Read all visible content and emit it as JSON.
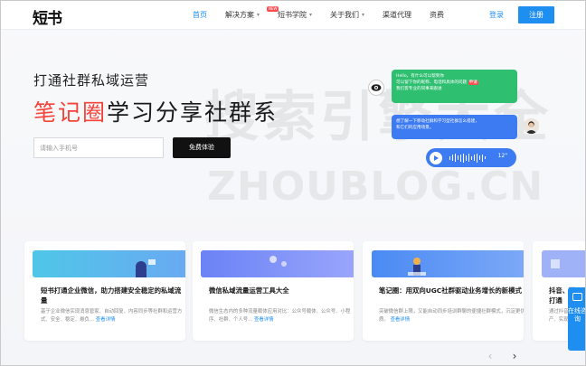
{
  "header": {
    "logo": "短书",
    "nav": [
      {
        "label": "首页",
        "active": true
      },
      {
        "label": "解决方案",
        "badge": "NEW",
        "dropdown": true
      },
      {
        "label": "短书学院",
        "dropdown": true
      },
      {
        "label": "关于我们",
        "dropdown": true
      },
      {
        "label": "渠道代理"
      },
      {
        "label": "资费"
      }
    ],
    "login": "登录",
    "register": "注册"
  },
  "hero": {
    "subtitle": "打通社群私域运营",
    "title_accent": "笔记圈",
    "title_rest": "学习分享社群系",
    "phone_placeholder": "请输入手机号",
    "cta": "免费体验"
  },
  "watermark": {
    "cn": "搜索引擎大全",
    "en": "ZHOUBLOG.CN"
  },
  "chat": {
    "bot_message_1": "Hello，有什么可以帮到你",
    "bot_message_2": "可以留下你的昵称、电话和具体的问题",
    "bot_message_tag": "申请",
    "bot_message_3": "我们客专业的同事来跟进",
    "user_message_1": "想了解一下移动社群和学习型社群怎么搭建，",
    "user_message_2": "和它们的应用场景。",
    "voice_duration": "12\""
  },
  "cards": [
    {
      "title": "短书打通企业微信，助力搭建安全稳定的私域流量",
      "desc": "基于企业微信实现消息管家、自动回复、内容同步等社群和运营方式、安全、稳定、悬负...",
      "more": "查看详情",
      "color_a": "#4fc6e8",
      "color_b": "#6aa9f2"
    },
    {
      "title": "微信私域流量运营工具大全",
      "desc": "微信生态内的多种流量载体应用对比：公众号载体、公众号、小程序、社群、个人号...",
      "more": "查看详情",
      "color_a": "#6a82f6",
      "color_b": "#9aa6fb"
    },
    {
      "title": "笔记圈：用双向UGC社群驱动业务增长的新模式",
      "desc": "突破微信群上限，又能自动同步培训群聊的便捷社群模式，沉淀更优质。",
      "more": "查看详情",
      "color_a": "#4a8af4",
      "color_b": "#7da9f7"
    },
    {
      "title": "抖音、面打通",
      "desc": "通过抖音产、实现",
      "more": "",
      "color_a": "#8fa5f5",
      "color_b": "#b3c1f8"
    }
  ],
  "pager": {
    "prev": "‹",
    "next": "›"
  },
  "side_consult": "在线咨询"
}
